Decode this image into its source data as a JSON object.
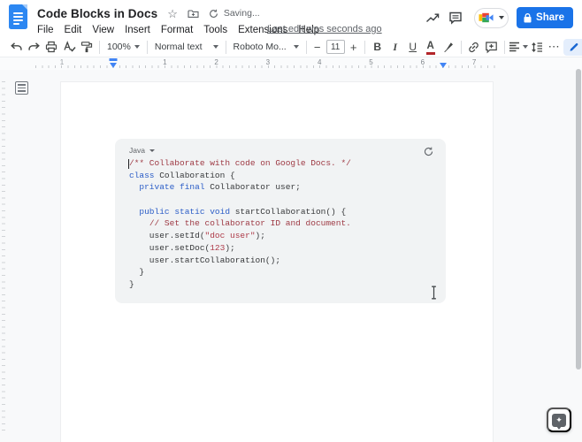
{
  "header": {
    "title": "Code Blocks in Docs",
    "saving_status": "Saving...",
    "menu_items": [
      "File",
      "Edit",
      "View",
      "Insert",
      "Format",
      "Tools",
      "Extensions",
      "Help"
    ],
    "last_edit": "Last edit was seconds ago",
    "share_label": "Share"
  },
  "toolbar": {
    "zoom_value": "100%",
    "paragraph_style": "Normal text",
    "font_name": "Roboto Mo...",
    "font_size": "11"
  },
  "ruler": {
    "margin_number": "1",
    "inch_numbers": [
      "1",
      "2",
      "3",
      "4",
      "5",
      "6",
      "7"
    ]
  },
  "document": {
    "code_block": {
      "language": "Java",
      "lines": [
        [
          {
            "t": "/** Collaborate with code on Google Docs. */",
            "c": "comment"
          }
        ],
        [
          {
            "t": "class",
            "c": "kw"
          },
          {
            "t": " Collaboration {",
            "c": "pl"
          }
        ],
        [
          {
            "t": "  ",
            "c": "pl"
          },
          {
            "t": "private final",
            "c": "kw"
          },
          {
            "t": " Collaborator user;",
            "c": "pl"
          }
        ],
        [],
        [
          {
            "t": "  ",
            "c": "pl"
          },
          {
            "t": "public static void",
            "c": "kw"
          },
          {
            "t": " startCollaboration() {",
            "c": "pl"
          }
        ],
        [
          {
            "t": "    ",
            "c": "pl"
          },
          {
            "t": "// Set the collaborator ID and document.",
            "c": "comment"
          }
        ],
        [
          {
            "t": "    user.setId(",
            "c": "pl"
          },
          {
            "t": "\"doc user\"",
            "c": "str"
          },
          {
            "t": ");",
            "c": "pl"
          }
        ],
        [
          {
            "t": "    user.setDoc(",
            "c": "pl"
          },
          {
            "t": "123",
            "c": "num"
          },
          {
            "t": ");",
            "c": "pl"
          }
        ],
        [
          {
            "t": "    user.startCollaboration();",
            "c": "pl"
          }
        ],
        [
          {
            "t": "  }",
            "c": "pl"
          }
        ],
        [
          {
            "t": "}",
            "c": "pl"
          }
        ]
      ]
    }
  },
  "icons": {
    "star": "☆",
    "more": "⋯",
    "minus": "−",
    "plus": "+",
    "bold": "B",
    "italic": "I",
    "underline": "U",
    "text_color": "A",
    "explore_star": "✦"
  },
  "colors": {
    "accent_blue": "#1a73e8",
    "code_keyword": "#2b5dc7",
    "code_comment": "#9e3a44",
    "code_string": "#ae3a48",
    "code_background": "#f1f3f4",
    "canvas_background": "#f8f9fa",
    "page_background": "#ffffff"
  }
}
